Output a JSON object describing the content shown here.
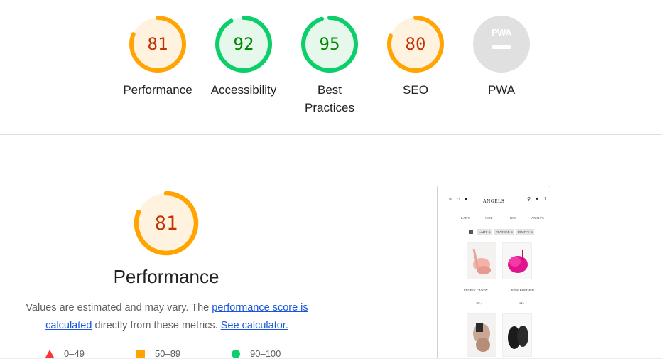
{
  "categories": [
    {
      "label": "Performance",
      "score": "81",
      "value": 81,
      "rating": "average"
    },
    {
      "label": "Accessibility",
      "score": "92",
      "value": 92,
      "rating": "pass"
    },
    {
      "label": "Best Practices",
      "score": "95",
      "value": 95,
      "rating": "pass"
    },
    {
      "label": "SEO",
      "score": "80",
      "value": 80,
      "rating": "average"
    },
    {
      "label": "PWA",
      "score": "",
      "value": null,
      "rating": "na",
      "badge": "PWA"
    }
  ],
  "colors": {
    "average_fg": "#c33300",
    "average_ring": "#ffa400",
    "average_bg": "#fff3e0",
    "pass_fg": "#008800",
    "pass_ring": "#0cce6b",
    "pass_bg": "#e6f8ec",
    "fail": "#ff3333",
    "na_bg": "#e0e0e0",
    "na_fg": "#ffffff",
    "link": "#1a56db"
  },
  "performance": {
    "score": "81",
    "value": 81,
    "title": "Performance",
    "desc_prefix": "Values are estimated and may vary. The ",
    "link_score": "performance score is calculated",
    "desc_middle": " directly from these metrics. ",
    "link_calc": "See calculator."
  },
  "legend": {
    "fail": "0–49",
    "average": "50–89",
    "pass": "90–100"
  },
  "preview": {
    "brand": "ANGELS",
    "cart_count": "1",
    "nav": [
      "LADY",
      "GIRL",
      "KID",
      "ANALYS"
    ],
    "chips": [
      "LADY X",
      "FEATHER X",
      "FLUFFY X"
    ],
    "products": [
      {
        "name": "FLUFFY CANDY",
        "price": "39€,-"
      },
      {
        "name": "PINK PANTHER",
        "price": "59€,-"
      }
    ]
  }
}
